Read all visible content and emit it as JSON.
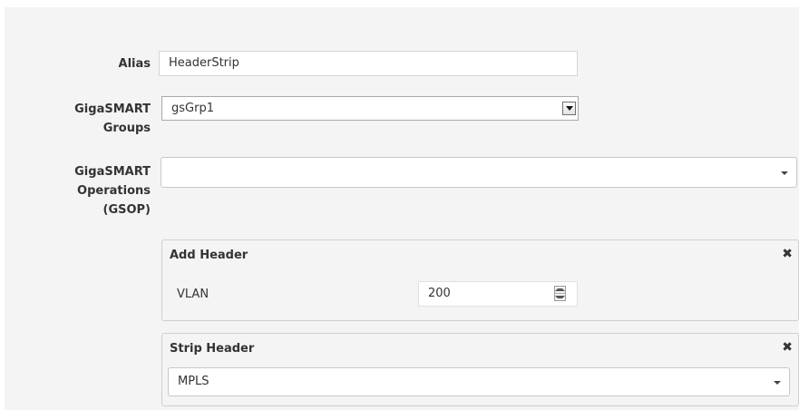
{
  "form": {
    "alias": {
      "label": "Alias",
      "value": "HeaderStrip"
    },
    "groups": {
      "label_line1": "GigaSMART",
      "label_line2": "Groups",
      "value": "gsGrp1"
    },
    "operations": {
      "label_line1": "GigaSMART",
      "label_line2": "Operations",
      "label_line3": "(GSOP)",
      "value": ""
    }
  },
  "add_header": {
    "title": "Add Header",
    "close_icon": "✖",
    "field_label": "VLAN",
    "field_value": "200"
  },
  "strip_header": {
    "title": "Strip Header",
    "close_icon": "✖",
    "selected": "MPLS"
  }
}
